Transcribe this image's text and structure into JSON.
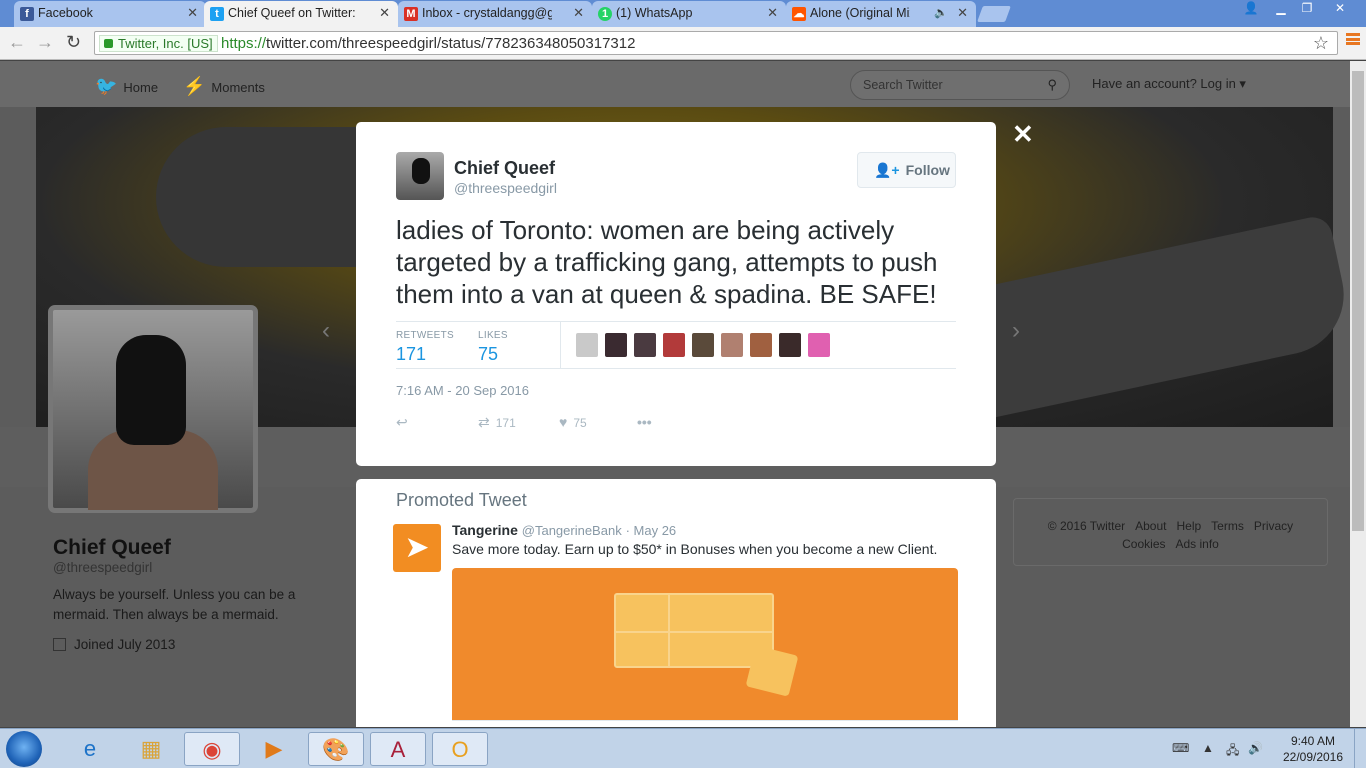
{
  "browser": {
    "tabs": [
      {
        "label": "Facebook",
        "icon": "facebook-icon",
        "color": "#3b5998"
      },
      {
        "label": "Chief Queef on Twitter: \"la",
        "icon": "twitter-icon",
        "color": "#1da1f2"
      },
      {
        "label": "Inbox - crystaldangg@gm",
        "icon": "gmail-icon",
        "color": "#d93025"
      },
      {
        "label": "(1) WhatsApp",
        "icon": "whatsapp-icon",
        "color": "#25d366"
      },
      {
        "label": "Alone (Original Mix) in",
        "icon": "soundcloud-icon",
        "color": "#ff5500"
      }
    ],
    "ev_label": "Twitter, Inc. [US]",
    "url_scheme": "https://",
    "url_rest": "twitter.com/threespeedgirl/status/778236348050317312"
  },
  "twitter_nav": {
    "home": "Home",
    "moments": "Moments",
    "search_placeholder": "Search Twitter",
    "login": "Have an account? Log in ▾"
  },
  "profile": {
    "name": "Chief Queef",
    "handle": "@threespeedgirl",
    "bio": "Always be yourself. Unless you can be a mermaid. Then always be a mermaid.",
    "joined": "Joined July 2013"
  },
  "footer": {
    "links": [
      "© 2016 Twitter",
      "About",
      "Help",
      "Terms",
      "Privacy",
      "Cookies",
      "Ads info"
    ]
  },
  "tweet": {
    "name": "Chief Queef",
    "handle": "@threespeedgirl",
    "follow_label": "Follow",
    "text": "ladies of Toronto: women are being actively targeted by a trafficking gang, attempts to push them into a van at queen & spadina. BE SAFE!",
    "retweets_label": "RETWEETS",
    "retweets": "171",
    "likes_label": "LIKES",
    "likes": "75",
    "timestamp": "7:16 AM - 20 Sep 2016",
    "action_retweets": "171",
    "action_likes": "75",
    "liker_colors": [
      "#c9c9c9",
      "#3a2a30",
      "#4a3a40",
      "#b23a3a",
      "#5a4a3a",
      "#b08070",
      "#a06040",
      "#3a2a2a",
      "#e060b0"
    ]
  },
  "promoted": {
    "title": "Promoted Tweet",
    "advertiser": "Tangerine",
    "handle": "@TangerineBank",
    "date": "· May 26",
    "text": "Save more today. Earn up to $50* in Bonuses when you become a new Client."
  },
  "taskbar": {
    "time": "9:40 AM",
    "date": "22/09/2016",
    "apps": [
      "ie-icon",
      "explorer-icon",
      "chrome-icon",
      "media-player-icon",
      "paint-icon",
      "access-icon",
      "outlook-icon"
    ]
  }
}
